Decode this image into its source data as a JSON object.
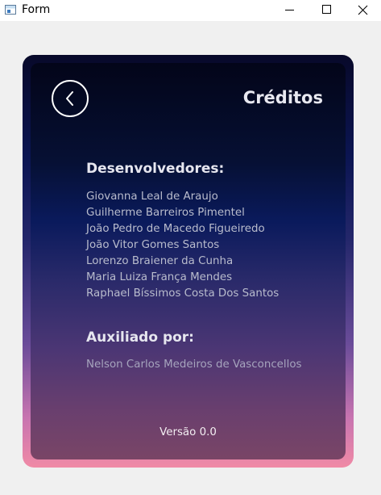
{
  "window": {
    "title": "Form"
  },
  "header": {
    "title": "Créditos"
  },
  "developers": {
    "title": "Desenvolvedores:",
    "names": [
      "Giovanna Leal de Araujo",
      "Guilherme Barreiros Pimentel",
      "João Pedro de Macedo Figueiredo",
      "João Vitor Gomes Santos",
      "Lorenzo Braiener da Cunha",
      "Maria Luiza França Mendes",
      "Raphael Bíssimos Costa Dos Santos"
    ]
  },
  "assisted": {
    "title": "Auxiliado por:",
    "name": "Nelson Carlos Medeiros de Vasconcellos"
  },
  "footer": {
    "version": "Versão 0.0"
  },
  "colors": {
    "window_bg": "#f0f0f0",
    "card_top": "#030519",
    "card_bottom": "#794566",
    "border_bottom": "#f08aa6",
    "text_primary": "#e6e6ef"
  },
  "icons": {
    "app": "window-app-icon",
    "back": "chevron-left-circle-icon",
    "minimize": "minimize-icon",
    "maximize": "maximize-icon",
    "close": "close-icon"
  }
}
